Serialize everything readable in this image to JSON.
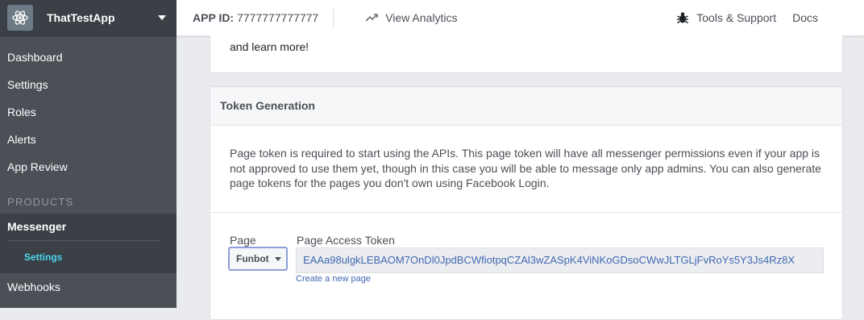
{
  "app": {
    "name": "ThatTestApp"
  },
  "sidebar": {
    "items": [
      {
        "label": "Dashboard"
      },
      {
        "label": "Settings"
      },
      {
        "label": "Roles"
      },
      {
        "label": "Alerts"
      },
      {
        "label": "App Review"
      }
    ],
    "products_label": "PRODUCTS",
    "messenger": {
      "label": "Messenger",
      "sub_items": [
        {
          "label": "Settings"
        }
      ]
    },
    "webhooks": {
      "label": "Webhooks"
    }
  },
  "topbar": {
    "app_id_label": "APP ID:",
    "app_id_value": "7777777777777",
    "analytics_label": "View Analytics",
    "tools_label": "Tools & Support",
    "docs_label": "Docs"
  },
  "content": {
    "top_card_text": "and learn more!",
    "token_section": {
      "title": "Token Generation",
      "description": "Page token is required to start using the APIs. This page token will have all messenger permissions even if your app is not approved to use them yet, though in this case you will be able to message only app admins. You can also generate page tokens for the pages you don't own using Facebook Login.",
      "page_label": "Page",
      "page_selected": "Funbot",
      "token_label": "Page Access Token",
      "token_value": "EAAa98ulgkLEBAOM7OnDl0JpdBCWfiotpqCZAl3wZASpK4ViNKoGDsoCWwJLTGLjFvRoYs5Y3Js4Rz8X",
      "create_link": "Create a new page"
    }
  },
  "colors": {
    "sidebar_bg": "#4b4f56",
    "sidebar_header_bg": "#3b3f46",
    "active_sub": "#4dd7ec",
    "link": "#4267b2"
  },
  "icons": {
    "app_logo": "atom-icon",
    "analytics": "trending-up-icon",
    "tools": "bug-icon",
    "dropdown": "caret-down-icon"
  }
}
